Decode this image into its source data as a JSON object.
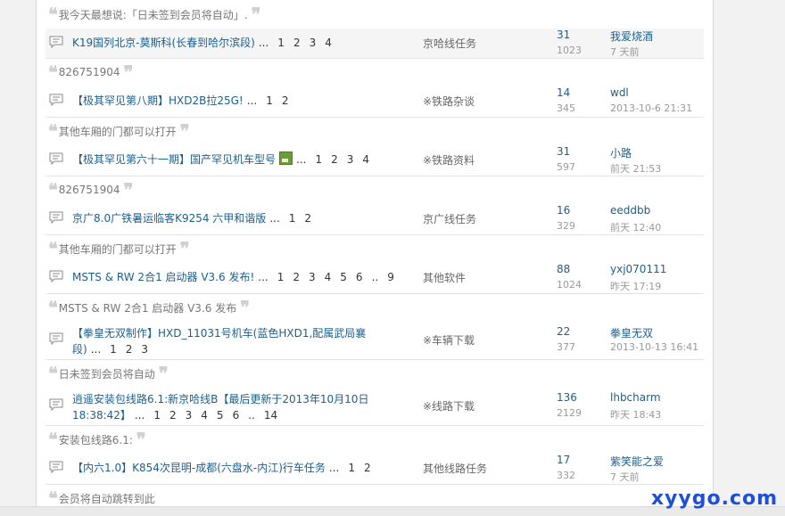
{
  "threads": [
    {
      "quote": "我今天最想说:「日未签到会员将自动」.",
      "title": "K19国列北京-莫斯科(长春到哈尔滨段)",
      "pages": [
        "...",
        "1",
        "2",
        "3",
        "4"
      ],
      "forum": "京哈线任务",
      "replies": "31",
      "views": "1023",
      "author": "我爱烧酒",
      "time": "7 天前",
      "img": false
    },
    {
      "quote": "826751904",
      "title": "【极其罕见第八期】HXD2B拉25G!",
      "pages": [
        "...",
        "1",
        "2"
      ],
      "forum": "※铁路杂谈",
      "replies": "14",
      "views": "345",
      "author": "wdl",
      "time": "2013-10-6 21:31",
      "img": false
    },
    {
      "quote": "其他车厢的门都可以打开",
      "title": "【极其罕见第六十一期】国产罕见机车型号",
      "pages": [
        "...",
        "1",
        "2",
        "3",
        "4"
      ],
      "forum": "※铁路资料",
      "replies": "31",
      "views": "597",
      "author": "小路",
      "time": "前天 21:53",
      "img": true
    },
    {
      "quote": "826751904",
      "title": "京广8.0广铁暑运临客K9254 六甲和谐版",
      "pages": [
        "...",
        "1",
        "2"
      ],
      "forum": "京广线任务",
      "replies": "16",
      "views": "329",
      "author": "eeddbb",
      "time": "前天 12:40",
      "img": false
    },
    {
      "quote": "其他车厢的门都可以打开",
      "title": "MSTS & RW 2合1 启动器 V3.6 发布!",
      "pages": [
        "...",
        "1",
        "2",
        "3",
        "4",
        "5",
        "6",
        "..",
        "9"
      ],
      "forum": "其他软件",
      "replies": "88",
      "views": "1024",
      "author": "yxj070111",
      "time": "昨天 17:19",
      "img": false
    },
    {
      "quote": "MSTS & RW 2合1 启动器 V3.6 发布",
      "title": "【拳皇无双制作】HXD_11031号机车(蓝色HXD1,配属武局襄",
      "title2": "段)",
      "pages": [
        "...",
        "1",
        "2",
        "3"
      ],
      "forum": "※车辆下载",
      "replies": "22",
      "views": "377",
      "author": "拳皇无双",
      "time": "2013-10-13 16:41",
      "img": false
    },
    {
      "quote": "日未签到会员将自动",
      "title": "逍遥安装包线路6.1:新京哈线B【最后更新于2013年10月10日",
      "title2": "18:38:42】",
      "pages": [
        "...",
        "1",
        "2",
        "3",
        "4",
        "5",
        "6",
        "..",
        "14"
      ],
      "forum": "※线路下载",
      "replies": "136",
      "views": "2129",
      "author": "lhbcharm",
      "time": "昨天 18:43",
      "img": false
    },
    {
      "quote": "安装包线路6.1:",
      "title": "【内六1.0】K854次昆明-成都(六盘水-内江)行车任务",
      "pages": [
        "...",
        "1",
        "2"
      ],
      "forum": "其他线路任务",
      "replies": "17",
      "views": "332",
      "author": "紫笑能之爱",
      "time": "7 天前",
      "img": false
    }
  ],
  "last_quote": "会员将自动跳转到此",
  "watermark": "xyygo.com",
  "colors": {
    "link": "#1d5f8a",
    "quote_mark": "#d0d0d0",
    "highlight_row": "#f5f5f5",
    "watermark": "#1e4fd6"
  }
}
